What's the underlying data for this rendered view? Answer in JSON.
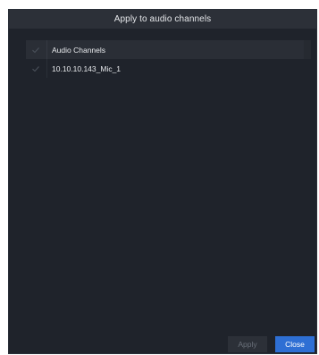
{
  "dialog": {
    "title": "Apply to audio channels"
  },
  "list": {
    "header_label": "Audio Channels",
    "header_checked": true,
    "rows": [
      {
        "label": "10.10.10.143_Mic_1",
        "checked": true
      }
    ]
  },
  "buttons": {
    "apply_label": "Apply",
    "close_label": "Close"
  },
  "colors": {
    "background": "#1f232b",
    "titlebar": "#2c3038",
    "accent": "#2e6fd4",
    "check_dim": "#4a505a"
  },
  "icons": {
    "check": "checkmark-icon"
  }
}
